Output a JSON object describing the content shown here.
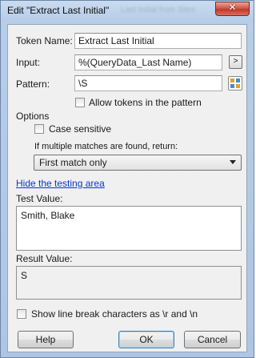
{
  "window": {
    "title": "Edit \"Extract Last Initial\"",
    "close_glyph": "✕"
  },
  "fields": {
    "token_name": {
      "label": "Token Name:",
      "value": "Extract Last Initial"
    },
    "input": {
      "label": "Input:",
      "value": "%(QueryData_Last Name)",
      "button_label": ">"
    },
    "pattern": {
      "label": "Pattern:",
      "value": "\\S",
      "token_icon": "token-picker-icon"
    },
    "allow_tokens": {
      "label": "Allow tokens in the pattern",
      "checked": false
    }
  },
  "options": {
    "heading": "Options",
    "case_sensitive": {
      "label": "Case sensitive",
      "checked": false
    },
    "multiple_matches_label": "If multiple matches are found, return:",
    "multiple_matches_selected": "First match only"
  },
  "testing": {
    "hide_link": "Hide the testing area",
    "test_value_label": "Test Value:",
    "test_value": "Smith, Blake",
    "result_value_label": "Result Value:",
    "result_value": "S",
    "show_line_breaks": {
      "label": "Show line break characters as \\r and \\n",
      "checked": false
    }
  },
  "buttons": {
    "help": "Help",
    "ok": "OK",
    "cancel": "Cancel"
  }
}
